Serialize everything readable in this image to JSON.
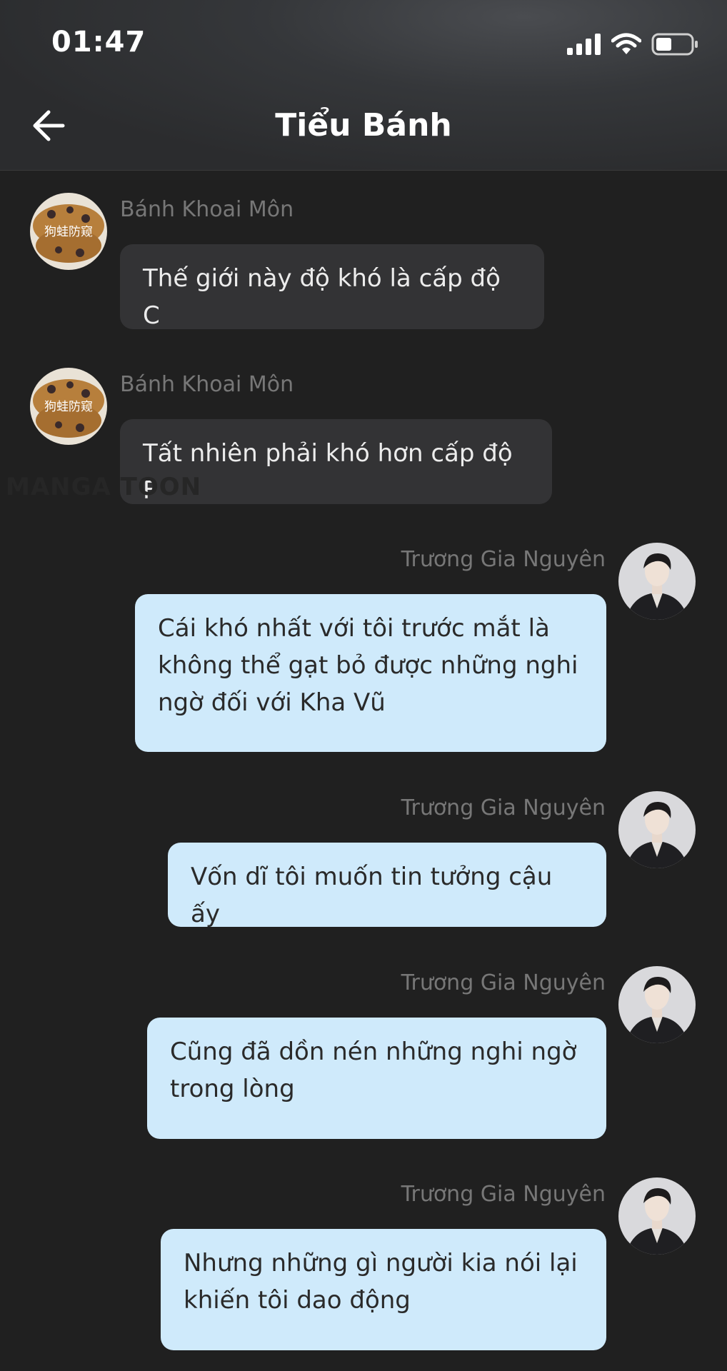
{
  "status_bar": {
    "time": "01:47",
    "icons": [
      "signal-icon",
      "wifi-icon",
      "battery-icon"
    ]
  },
  "header": {
    "back_icon": "arrow-left-icon",
    "title": "Tiểu Bánh"
  },
  "watermark": "MANGA TOON",
  "messages": [
    {
      "sender": "Bánh Khoai Môn",
      "text": "Thế giới này độ khó là cấp độ C",
      "direction": "incoming"
    },
    {
      "sender": "Bánh Khoai Môn",
      "text": "Tất nhiên phải khó hơn cấp độ F",
      "direction": "incoming"
    },
    {
      "sender": "Trương Gia Nguyên",
      "text": "Cái khó nhất với tôi trước mắt là không thể gạt bỏ được những nghi ngờ đối với Kha Vũ",
      "direction": "outgoing"
    },
    {
      "sender": "Trương Gia Nguyên",
      "text": "Vốn dĩ tôi muốn tin tưởng cậu ấy",
      "direction": "outgoing"
    },
    {
      "sender": "Trương Gia Nguyên",
      "text": "Cũng đã dồn nén những nghi ngờ trong lòng",
      "direction": "outgoing"
    },
    {
      "sender": "Trương Gia Nguyên",
      "text": "Nhưng những gì người kia nói lại khiến tôi dao động",
      "direction": "outgoing"
    }
  ],
  "avatar_labels": {
    "cake": "狗蛙防窥"
  },
  "colors": {
    "background": "#202020",
    "incoming_bubble": "#333335",
    "outgoing_bubble": "#cfeafb"
  }
}
